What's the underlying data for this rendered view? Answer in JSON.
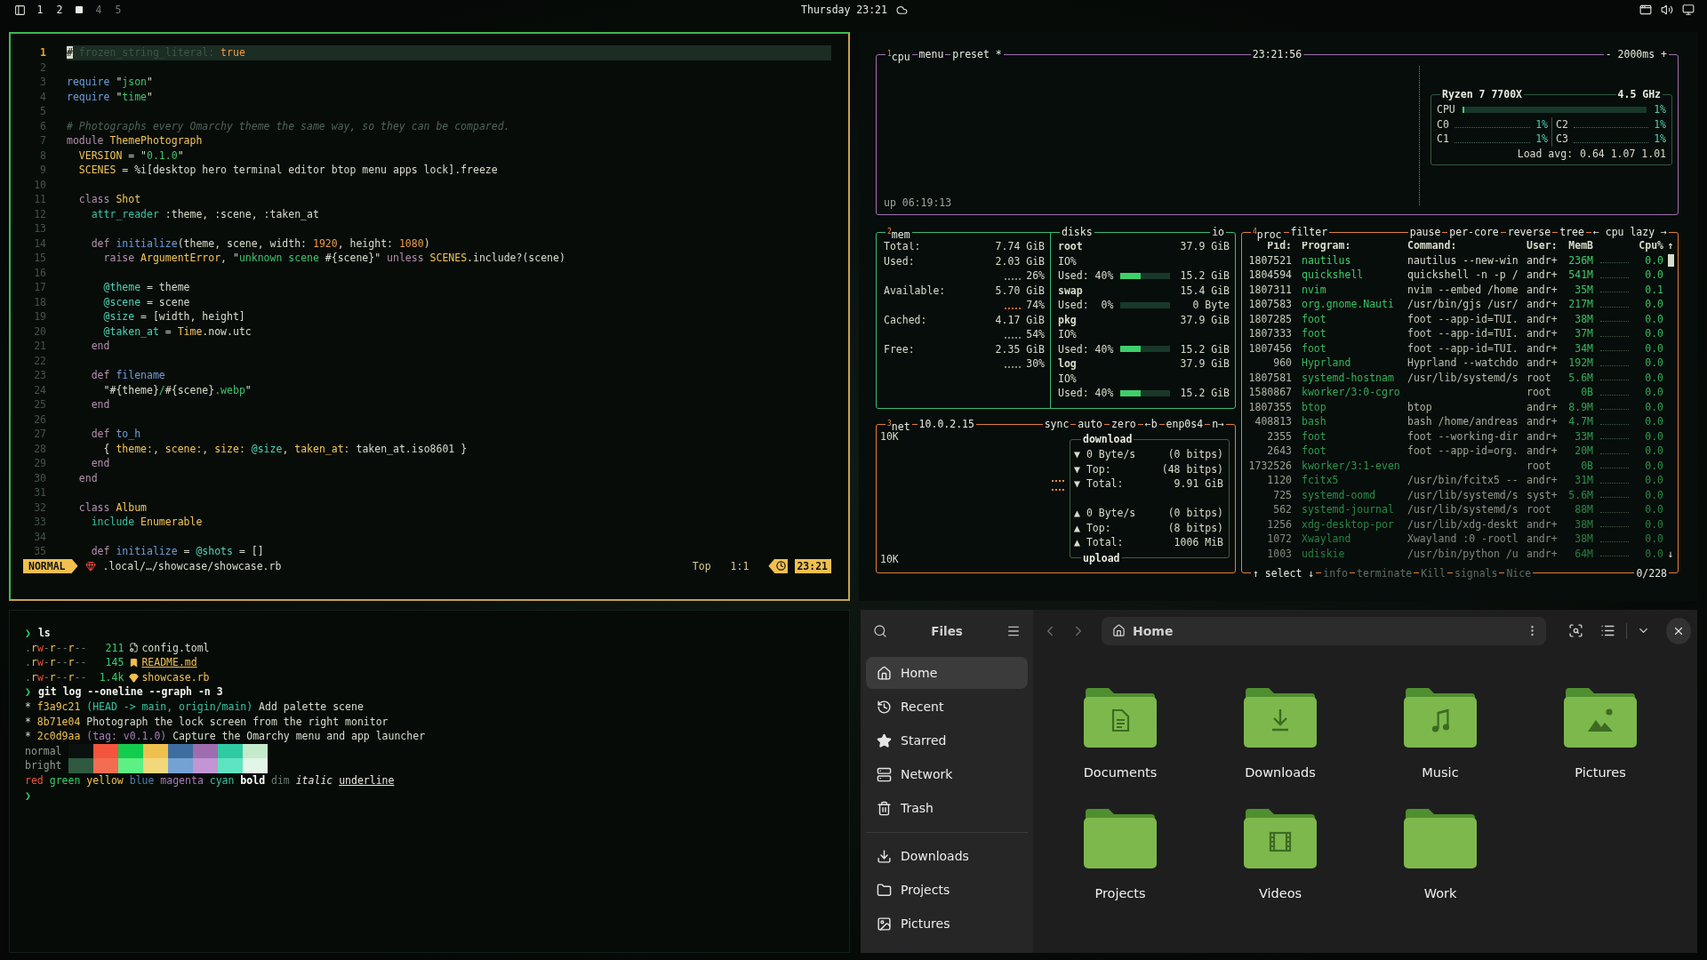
{
  "top_bar": {
    "workspaces": [
      {
        "label": "1",
        "selected": false,
        "occupied": true
      },
      {
        "label": "2",
        "selected": false,
        "occupied": true
      },
      {
        "selected": true,
        "occupied": true
      },
      {
        "label": "4",
        "selected": false,
        "occupied": false
      },
      {
        "label": "5",
        "selected": false,
        "occupied": false
      }
    ],
    "clock": "Thursday 23:21"
  },
  "editor": {
    "lines": [
      {
        "number": "1",
        "current": true,
        "tokens": [
          {
            "kind": "cur",
            "text": "#"
          },
          {
            "kind": "cmf",
            "text": " frozen_string_literal:"
          },
          {
            "kind": "n",
            "text": " true"
          }
        ]
      },
      {
        "number": "2",
        "current": false
      },
      {
        "number": "3",
        "current": false,
        "tokens": [
          {
            "kind": "fn",
            "text": "require"
          },
          {
            "kind": "p",
            "text": " \""
          },
          {
            "kind": "s",
            "text": "json"
          },
          {
            "kind": "p",
            "text": "\""
          }
        ]
      },
      {
        "number": "4",
        "current": false,
        "tokens": [
          {
            "kind": "fn",
            "text": "require"
          },
          {
            "kind": "p",
            "text": " \""
          },
          {
            "kind": "s",
            "text": "time"
          },
          {
            "kind": "p",
            "text": "\""
          }
        ]
      },
      {
        "number": "5",
        "current": false
      },
      {
        "number": "6",
        "current": false,
        "tokens": [
          {
            "kind": "cm",
            "text": "# Photographs every Omarchy theme the same way, so they can be compared."
          }
        ]
      },
      {
        "number": "7",
        "current": false,
        "tokens": [
          {
            "kind": "kw",
            "text": "module "
          },
          {
            "kind": "c",
            "text": "ThemePhotograph"
          }
        ]
      },
      {
        "number": "8",
        "current": false,
        "tokens": [
          {
            "kind": "c",
            "text": "  VERSION"
          },
          {
            "kind": "p",
            "text": " = \""
          },
          {
            "kind": "s",
            "text": "0.1.0"
          },
          {
            "kind": "p",
            "text": "\""
          }
        ]
      },
      {
        "number": "9",
        "current": false,
        "tokens": [
          {
            "kind": "c",
            "text": "  SCENES"
          },
          {
            "kind": "p",
            "text": " = %i[desktop hero terminal editor btop menu apps lock].freeze"
          }
        ]
      },
      {
        "number": "10",
        "current": false
      },
      {
        "number": "11",
        "current": false,
        "tokens": [
          {
            "kind": "kw",
            "text": "  class "
          },
          {
            "kind": "c",
            "text": "Shot"
          }
        ]
      },
      {
        "number": "12",
        "current": false,
        "tokens": [
          {
            "kind": "t",
            "text": "    attr_reader"
          },
          {
            "kind": "p",
            "text": " :theme, :scene, :taken_at"
          }
        ]
      },
      {
        "number": "13",
        "current": false
      },
      {
        "number": "14",
        "current": false,
        "tokens": [
          {
            "kind": "kw",
            "text": "    def "
          },
          {
            "kind": "fn",
            "text": "initialize"
          },
          {
            "kind": "p",
            "text": "(theme, scene, width: "
          },
          {
            "kind": "n",
            "text": "1920"
          },
          {
            "kind": "p",
            "text": ", height: "
          },
          {
            "kind": "n",
            "text": "1080"
          },
          {
            "kind": "p",
            "text": ")"
          }
        ]
      },
      {
        "number": "15",
        "current": false,
        "tokens": [
          {
            "kind": "kw",
            "text": "      raise "
          },
          {
            "kind": "c",
            "text": "ArgumentError"
          },
          {
            "kind": "p",
            "text": ", \""
          },
          {
            "kind": "s",
            "text": "unknown scene "
          },
          {
            "kind": "p",
            "text": "#{scene}\" "
          },
          {
            "kind": "kw",
            "text": "unless "
          },
          {
            "kind": "c",
            "text": "SCENES"
          },
          {
            "kind": "p",
            "text": ".include?(scene)"
          }
        ]
      },
      {
        "number": "16",
        "current": false
      },
      {
        "number": "17",
        "current": false,
        "tokens": [
          {
            "kind": "iv",
            "text": "      @theme"
          },
          {
            "kind": "p",
            "text": " = theme"
          }
        ]
      },
      {
        "number": "18",
        "current": false,
        "tokens": [
          {
            "kind": "iv",
            "text": "      @scene"
          },
          {
            "kind": "p",
            "text": " = scene"
          }
        ]
      },
      {
        "number": "19",
        "current": false,
        "tokens": [
          {
            "kind": "iv",
            "text": "      @size"
          },
          {
            "kind": "p",
            "text": " = [width, height]"
          }
        ]
      },
      {
        "number": "20",
        "current": false,
        "tokens": [
          {
            "kind": "iv",
            "text": "      @taken_at"
          },
          {
            "kind": "p",
            "text": " = "
          },
          {
            "kind": "c",
            "text": "Time"
          },
          {
            "kind": "p",
            "text": ".now.utc"
          }
        ]
      },
      {
        "number": "21",
        "current": false,
        "tokens": [
          {
            "kind": "kw",
            "text": "    end"
          }
        ]
      },
      {
        "number": "22",
        "current": false
      },
      {
        "number": "23",
        "current": false,
        "tokens": [
          {
            "kind": "kw",
            "text": "    def "
          },
          {
            "kind": "fn",
            "text": "filename"
          }
        ]
      },
      {
        "number": "24",
        "current": false,
        "tokens": [
          {
            "kind": "p",
            "text": "      \"#{theme}"
          },
          {
            "kind": "s",
            "text": "/"
          },
          {
            "kind": "p",
            "text": "#{scene}"
          },
          {
            "kind": "s",
            "text": ".webp"
          },
          {
            "kind": "p",
            "text": "\""
          }
        ]
      },
      {
        "number": "25",
        "current": false,
        "tokens": [
          {
            "kind": "kw",
            "text": "    end"
          }
        ]
      },
      {
        "number": "26",
        "current": false
      },
      {
        "number": "27",
        "current": false,
        "tokens": [
          {
            "kind": "kw",
            "text": "    def "
          },
          {
            "kind": "fn",
            "text": "to_h"
          }
        ]
      },
      {
        "number": "28",
        "current": false,
        "tokens": [
          {
            "kind": "p",
            "text": "      { "
          },
          {
            "kind": "c",
            "text": "theme:"
          },
          {
            "kind": "p",
            "text": ", "
          },
          {
            "kind": "c",
            "text": "scene:"
          },
          {
            "kind": "p",
            "text": ", "
          },
          {
            "kind": "c",
            "text": "size:"
          },
          {
            "kind": "iv",
            "text": " @size"
          },
          {
            "kind": "p",
            "text": ", "
          },
          {
            "kind": "c",
            "text": "taken_at:"
          },
          {
            "kind": "p",
            "text": " taken_at.iso8601 }"
          }
        ]
      },
      {
        "number": "29",
        "current": false,
        "tokens": [
          {
            "kind": "kw",
            "text": "    end"
          }
        ]
      },
      {
        "number": "30",
        "current": false,
        "tokens": [
          {
            "kind": "kw",
            "text": "  end"
          }
        ]
      },
      {
        "number": "31",
        "current": false
      },
      {
        "number": "32",
        "current": false,
        "tokens": [
          {
            "kind": "kw",
            "text": "  class "
          },
          {
            "kind": "c",
            "text": "Album"
          }
        ]
      },
      {
        "number": "33",
        "current": false,
        "tokens": [
          {
            "kind": "t",
            "text": "    include "
          },
          {
            "kind": "c",
            "text": "Enumerable"
          }
        ]
      },
      {
        "number": "34",
        "current": false
      },
      {
        "number": "35",
        "current": false,
        "tokens": [
          {
            "kind": "kw",
            "text": "    def "
          },
          {
            "kind": "fn",
            "text": "initialize"
          },
          {
            "kind": "p",
            "text": " = "
          },
          {
            "kind": "iv",
            "text": "@shots"
          },
          {
            "kind": "p",
            "text": " = []"
          }
        ]
      }
    ],
    "status": {
      "mode": "NORMAL",
      "path": ".local/…/showcase/showcase.rb",
      "position": "Top",
      "cursor": "1:1",
      "time": "23:21"
    }
  },
  "btop": {
    "cpu": {
      "title": [
        {
          "number": "1",
          "label": "cpu"
        },
        {
          "label": "menu"
        },
        {
          "label": "preset *"
        }
      ],
      "clock": "23:21:56",
      "interval": "- 2000ms +",
      "uptime": "up 06:19:13",
      "model": "Ryzen 7 7700X",
      "frequency": "4.5 GHz",
      "total": {
        "label": "CPU",
        "level": 0.01,
        "reading": "1%"
      },
      "cores": [
        {
          "label": "C0",
          "reading": "1%"
        },
        {
          "label": "C1",
          "reading": "1%"
        },
        {
          "label": "C2",
          "reading": "1%"
        },
        {
          "label": "C3",
          "reading": "1%"
        }
      ],
      "load_label": "Load avg:",
      "load": "0.64 1.07 1.01"
    },
    "mem": {
      "title": {
        "number": "2",
        "label": "mem"
      },
      "rows": [
        {
          "label": "Total:",
          "value": "7.74 GiB"
        },
        {
          "label": "Used:",
          "value": "2.03 GiB",
          "percent": "26%"
        },
        {
          "label": "Available:",
          "value": "5.70 GiB",
          "percent": "74%"
        },
        {
          "label": "Cached:",
          "value": "4.17 GiB",
          "percent": "54%"
        },
        {
          "label": "Free:",
          "value": "2.35 GiB",
          "percent": "30%"
        }
      ]
    },
    "disks": {
      "title": "disks",
      "io_title": "io",
      "items": [
        {
          "name": "root",
          "size": "37.9 GiB",
          "io": "IO%",
          "used_label": "Used: 40%",
          "level": 0.4,
          "used": "15.2 GiB"
        },
        {
          "name": "swap",
          "size": "15.4 GiB",
          "used_label": "Used:  0%",
          "level": 0,
          "used": "0 Byte"
        },
        {
          "name": "pkg",
          "size": "37.9 GiB",
          "io": "IO%",
          "used_label": "Used: 40%",
          "level": 0.4,
          "used": "15.2 GiB"
        },
        {
          "name": "log",
          "size": "37.9 GiB",
          "io": "IO%",
          "used_label": "Used: 40%",
          "level": 0.4,
          "used": "15.2 GiB"
        }
      ]
    },
    "net": {
      "title": {
        "number": "3",
        "label": "net"
      },
      "address": "10.0.2.15",
      "controls": [
        "sync",
        "auto",
        "zero",
        "←b",
        "enp0s4",
        "n→"
      ],
      "scale_top": "10K",
      "scale_bottom": "10K",
      "download": {
        "title": "download",
        "rows": [
          {
            "arrow": "▼",
            "label": "0 Byte/s",
            "value": "(0 bitps)"
          },
          {
            "arrow": "▼",
            "label": "Top:",
            "value": "(48 bitps)"
          },
          {
            "arrow": "▼",
            "label": "Total:",
            "value": "9.91 GiB"
          }
        ]
      },
      "upload": {
        "title": "upload",
        "rows": [
          {
            "arrow": "▲",
            "label": "0 Byte/s",
            "value": "(0 bitps)"
          },
          {
            "arrow": "▲",
            "label": "Top:",
            "value": "(8 bitps)"
          },
          {
            "arrow": "▲",
            "label": "Total:",
            "value": "1006 MiB"
          }
        ]
      }
    },
    "proc": {
      "title": {
        "number": "4",
        "label": "proc"
      },
      "filter": "filter",
      "controls": [
        "pause",
        "per-core",
        "reverse",
        "tree",
        "← cpu lazy →"
      ],
      "columns": [
        "Pid:",
        "Program:",
        "Command:",
        "User:",
        "MemB",
        "Cpu%"
      ],
      "sort_arrow": "↑",
      "scroll_arrow": "↓",
      "rows": [
        {
          "pid": "1807521",
          "program": "nautilus",
          "command": "nautilus --new-win",
          "user": "andr+",
          "mem": "236M",
          "cpu": "0.0"
        },
        {
          "pid": "1804594",
          "program": "quickshell",
          "command": "quickshell -n -p /",
          "user": "andr+",
          "mem": "541M",
          "cpu": "0.0"
        },
        {
          "pid": "1807311",
          "program": "nvim",
          "command": "nvim --embed /home",
          "user": "andr+",
          "mem": "35M",
          "cpu": "0.1"
        },
        {
          "pid": "1807583",
          "program": "org.gnome.Nauti",
          "command": "/usr/bin/gjs /usr/",
          "user": "andr+",
          "mem": "217M",
          "cpu": "0.0"
        },
        {
          "pid": "1807285",
          "program": "foot",
          "command": "foot --app-id=TUI.",
          "user": "andr+",
          "mem": "38M",
          "cpu": "0.0"
        },
        {
          "pid": "1807333",
          "program": "foot",
          "command": "foot --app-id=TUI.",
          "user": "andr+",
          "mem": "37M",
          "cpu": "0.0"
        },
        {
          "pid": "1807456",
          "program": "foot",
          "command": "foot --app-id=TUI.",
          "user": "andr+",
          "mem": "34M",
          "cpu": "0.0"
        },
        {
          "pid": "960",
          "program": "Hyprland",
          "command": "Hyprland --watchdo",
          "user": "andr+",
          "mem": "192M",
          "cpu": "0.0"
        },
        {
          "pid": "1807581",
          "program": "systemd-hostnam",
          "command": "/usr/lib/systemd/s",
          "user": "root",
          "mem": "5.6M",
          "cpu": "0.0"
        },
        {
          "pid": "1580867",
          "program": "kworker/3:0-cgro",
          "user": "root",
          "mem": "0B",
          "cpu": "0.0"
        },
        {
          "pid": "1807355",
          "program": "btop",
          "command": "btop",
          "user": "andr+",
          "mem": "8.9M",
          "cpu": "0.0"
        },
        {
          "pid": "408813",
          "program": "bash",
          "command": "bash /home/andreas",
          "user": "andr+",
          "mem": "4.7M",
          "cpu": "0.0"
        },
        {
          "pid": "2355",
          "program": "foot",
          "command": "foot --working-dir",
          "user": "andr+",
          "mem": "33M",
          "cpu": "0.0"
        },
        {
          "pid": "2643",
          "program": "foot",
          "command": "foot --app-id=org.",
          "user": "andr+",
          "mem": "20M",
          "cpu": "0.0"
        },
        {
          "pid": "1732526",
          "program": "kworker/3:1-even",
          "user": "root",
          "mem": "0B",
          "cpu": "0.0"
        },
        {
          "pid": "1120",
          "program": "fcitx5",
          "command": "/usr/bin/fcitx5 --",
          "user": "andr+",
          "mem": "31M",
          "cpu": "0.0"
        },
        {
          "pid": "725",
          "program": "systemd-oomd",
          "command": "/usr/lib/systemd/s",
          "user": "syst+",
          "mem": "5.6M",
          "cpu": "0.0"
        },
        {
          "pid": "562",
          "program": "systemd-journal",
          "command": "/usr/lib/systemd/s",
          "user": "root",
          "mem": "88M",
          "cpu": "0.0"
        },
        {
          "pid": "1256",
          "program": "xdg-desktop-por",
          "command": "/usr/lib/xdg-deskt",
          "user": "andr+",
          "mem": "38M",
          "cpu": "0.0"
        },
        {
          "pid": "1072",
          "program": "Xwayland",
          "command": "Xwayland :0 -rootl",
          "user": "andr+",
          "mem": "38M",
          "cpu": "0.0"
        },
        {
          "pid": "1003",
          "program": "udiskie",
          "command": "/usr/bin/python /u",
          "user": "andr+",
          "mem": "64M",
          "cpu": "0.0"
        }
      ],
      "footer": [
        "↑ select ↓",
        "info",
        "terminate",
        "Kill",
        "signals",
        "Nice"
      ],
      "count": "0/228"
    }
  },
  "terminal": {
    "lines": [
      {
        "kind": "prompt",
        "symbol": "❯",
        "command": "ls"
      },
      {
        "kind": "ls",
        "permissions": ".rw-r--r--",
        "size": "211",
        "icon": {
          "kind": "config"
        },
        "name": "config.toml"
      },
      {
        "kind": "ls",
        "permissions": ".rw-r--r--",
        "size": "145",
        "icon": {
          "kind": "markdown"
        },
        "name": "README.md"
      },
      {
        "kind": "ls",
        "permissions": ".rw-r--r--",
        "size": "1.4k",
        "icon": {
          "kind": "ruby"
        },
        "name": "showcase.rb"
      },
      {
        "kind": "prompt",
        "symbol": "❯",
        "command": "git log --oneline --graph -n 3"
      },
      {
        "kind": "text",
        "tokens": [
          {
            "kind": "p",
            "text": "* "
          },
          {
            "kind": "y",
            "text": "f3a9c21 "
          },
          {
            "kind": "t",
            "text": "(HEAD -> main, origin/main)"
          },
          {
            "kind": "p",
            "text": " Add palette scene"
          }
        ]
      },
      {
        "kind": "text",
        "tokens": [
          {
            "kind": "p",
            "text": "* "
          },
          {
            "kind": "y",
            "text": "8b71e04"
          },
          {
            "kind": "p",
            "text": " Photograph the lock screen from the right monitor"
          }
        ]
      },
      {
        "kind": "text",
        "tokens": [
          {
            "kind": "p",
            "text": "* "
          },
          {
            "kind": "y",
            "text": "2c0d9aa "
          },
          {
            "kind": "m",
            "text": "(tag: v0.1.0)"
          },
          {
            "kind": "p",
            "text": " Capture the Omarchy menu and app launcher"
          }
        ]
      },
      {
        "kind": "palette",
        "label": "normal",
        "swatches": [
          {
            "color": "#0b110e"
          },
          {
            "color": "#f2553b"
          },
          {
            "color": "#12cc4e"
          },
          {
            "color": "#f0c04e"
          },
          {
            "color": "#3e6ea0"
          },
          {
            "color": "#a06cb0"
          },
          {
            "color": "#2ecba3"
          },
          {
            "color": "#c3ebcb"
          }
        ]
      },
      {
        "kind": "palette",
        "label": "bright",
        "swatches": [
          {
            "color": "#2f5a40"
          },
          {
            "color": "#f36d52"
          },
          {
            "color": "#5cf185"
          },
          {
            "color": "#f2d87c"
          },
          {
            "color": "#74a2d2"
          },
          {
            "color": "#c295d4"
          },
          {
            "color": "#5ee4c2"
          },
          {
            "color": "#e2f5e7"
          }
        ]
      },
      {
        "kind": "text",
        "tokens": [
          {
            "kind": "r",
            "text": "red "
          },
          {
            "kind": "g",
            "text": "green "
          },
          {
            "kind": "y",
            "text": "yellow "
          },
          {
            "kind": "b",
            "text": "blue "
          },
          {
            "kind": "m",
            "text": "magenta "
          },
          {
            "kind": "t",
            "text": "cyan "
          },
          {
            "kind": "bold",
            "text": "bold "
          },
          {
            "kind": "dim",
            "text": "dim "
          },
          {
            "kind": "it",
            "text": "italic "
          },
          {
            "kind": "ul",
            "text": "underline"
          }
        ]
      },
      {
        "kind": "prompt",
        "symbol": "❯"
      }
    ]
  },
  "files": {
    "title": "Files",
    "location": "Home",
    "places": [
      {
        "label": "Home",
        "kind": "home",
        "selected": true
      },
      {
        "label": "Recent",
        "kind": "recent",
        "selected": false
      },
      {
        "label": "Starred",
        "kind": "starred",
        "selected": false
      },
      {
        "label": "Network",
        "kind": "network",
        "selected": false
      },
      {
        "label": "Trash",
        "kind": "trash",
        "selected": false
      }
    ],
    "bookmarks": [
      {
        "label": "Downloads",
        "kind": "downloads",
        "selected": false
      },
      {
        "label": "Projects",
        "kind": "folder",
        "selected": false
      },
      {
        "label": "Pictures",
        "kind": "pictures",
        "selected": false
      }
    ],
    "folders": [
      {
        "label": "Documents",
        "kind": "documents"
      },
      {
        "label": "Downloads",
        "kind": "downloads"
      },
      {
        "label": "Music",
        "kind": "music"
      },
      {
        "label": "Pictures",
        "kind": "pictures"
      },
      {
        "label": "Projects",
        "kind": "plain"
      },
      {
        "label": "Videos",
        "kind": "videos"
      },
      {
        "label": "Work",
        "kind": "plain"
      }
    ]
  }
}
